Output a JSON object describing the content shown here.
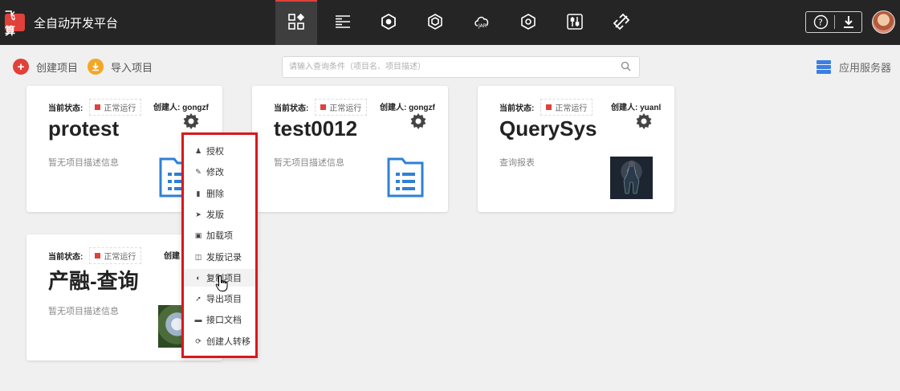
{
  "header": {
    "logo_text": "飞算",
    "title": "全自动开发平台",
    "nav_icons": [
      "dashboard-icon",
      "list-icon",
      "hexagon-icon",
      "cube-icon",
      "cloud-jar-icon",
      "network-icon",
      "settings-sliders-icon",
      "link-icon"
    ],
    "help_icon": "question-circle-icon",
    "download_icon": "download-icon",
    "accent_color": "#e0413a"
  },
  "toolbar": {
    "create_label": "创建项目",
    "import_label": "导入项目",
    "search_placeholder": "请输入查询条件（项目名、项目描述）",
    "app_server_label": "应用服务器"
  },
  "projects": [
    {
      "status_label": "当前状态:",
      "status": "正常运行",
      "creator": "创建人: gongzf",
      "name": "protest",
      "desc": "暂无项目描述信息"
    },
    {
      "status_label": "当前状态:",
      "status": "正常运行",
      "creator": "创建人: gongzf",
      "name": "test0012",
      "desc": "暂无项目描述信息"
    },
    {
      "status_label": "当前状态:",
      "status": "正常运行",
      "creator": "创建人: yuanl",
      "name": "QuerySys",
      "desc": "查询报表"
    },
    {
      "status_label": "当前状态:",
      "status": "正常运行",
      "creator": "创建",
      "name": "产融-查询",
      "desc": "暂无项目描述信息"
    }
  ],
  "context_menu": {
    "items": [
      {
        "label": "授权",
        "icon": "user-icon"
      },
      {
        "label": "修改",
        "icon": "edit-icon"
      },
      {
        "label": "删除",
        "icon": "trash-icon"
      },
      {
        "label": "发版",
        "icon": "send-icon"
      },
      {
        "label": "加载项",
        "icon": "plugin-icon"
      },
      {
        "label": "发版记录",
        "icon": "record-icon"
      },
      {
        "label": "复制项目",
        "icon": "copy-icon"
      },
      {
        "label": "导出项目",
        "icon": "export-icon"
      },
      {
        "label": "接口文档",
        "icon": "doc-icon"
      },
      {
        "label": "创建人转移",
        "icon": "transfer-icon"
      }
    ],
    "highlighted": "复制项目"
  }
}
